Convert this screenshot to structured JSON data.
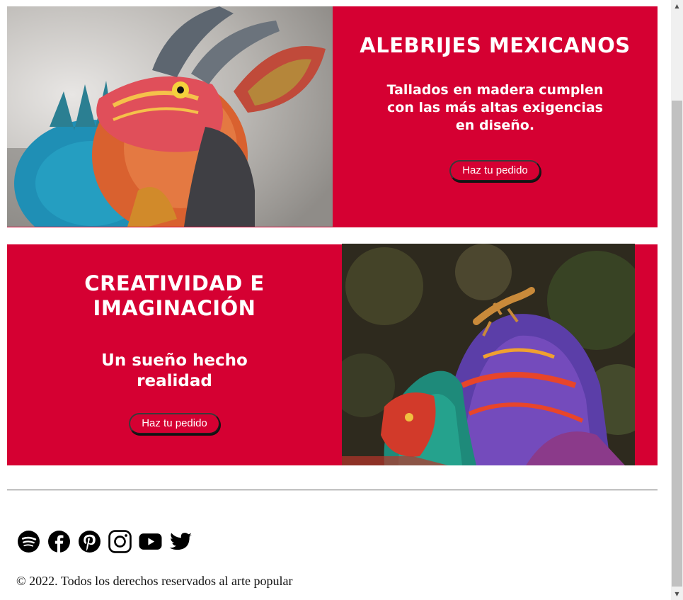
{
  "banners": [
    {
      "title": "ALEBRIJES MEXICANOS",
      "subtitle": "Tallados en madera cumplen con las más altas exigencias en diseño.",
      "button_label": "Haz tu pedido",
      "image_subject": "alebrije-armadillo-photo"
    },
    {
      "title": "CREATIVIDAD E IMAGINACIÓN",
      "subtitle": "Un sueño hecho realidad",
      "button_label": "Haz tu pedido",
      "image_subject": "alebrije-creatures-photo"
    }
  ],
  "footer": {
    "social_icons": [
      "spotify-icon",
      "facebook-icon",
      "pinterest-icon",
      "instagram-icon",
      "youtube-icon",
      "twitter-icon"
    ],
    "copyright": "© 2022. Todos los derechos reservados al arte popular"
  },
  "colors": {
    "banner_background": "#d50032",
    "text": "#ffffff",
    "footer_text": "#111111"
  }
}
